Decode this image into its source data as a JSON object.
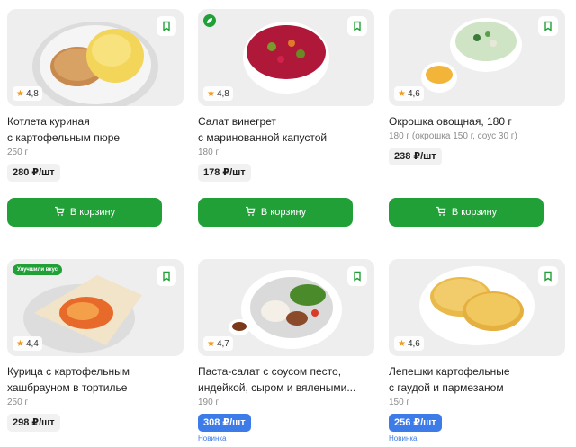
{
  "products": [
    {
      "title_lines": [
        "Котлета куриная",
        "с картофельным пюре"
      ],
      "rating": "4,8",
      "weight": "250 г",
      "price": "280 ₽/шт",
      "button": "В корзину",
      "icon": "bookmark-icon"
    },
    {
      "title_lines": [
        "Салат винегрет",
        "с маринованной капустой"
      ],
      "rating": "4,8",
      "weight": "180 г",
      "price": "178 ₽/шт",
      "button": "В корзину",
      "icon": "bookmark-icon",
      "badge_icon": "leaf-icon"
    },
    {
      "title_lines": [
        "Окрошка овощная, 180 г"
      ],
      "rating": "4,6",
      "weight": "180 г (окрошка 150 г, соус 30 г)",
      "price": "238 ₽/шт",
      "button": "В корзину",
      "icon": "bookmark-icon"
    },
    {
      "title_lines": [
        "Курица с картофельным",
        "хашбрауном в тортилье"
      ],
      "rating": "4,4",
      "weight": "250 г",
      "price": "298 ₽/шт",
      "promo": "Улучшили вкус",
      "icon": "bookmark-icon"
    },
    {
      "title_lines": [
        "Паста-салат с соусом песто,",
        "индейкой, сыром и вялеными..."
      ],
      "rating": "4,7",
      "weight": "190 г",
      "price": "308 ₽/шт",
      "new_label": "Новинка",
      "icon": "bookmark-icon"
    },
    {
      "title_lines": [
        "Лепешки картофельные",
        "с гаудой и пармезаном"
      ],
      "rating": "4,6",
      "weight": "150 г",
      "price": "256 ₽/шт",
      "new_label": "Новинка",
      "icon": "bookmark-icon"
    }
  ],
  "colors": {
    "accent": "#21a038",
    "new": "#3d7be8",
    "star": "#f29a1a"
  }
}
